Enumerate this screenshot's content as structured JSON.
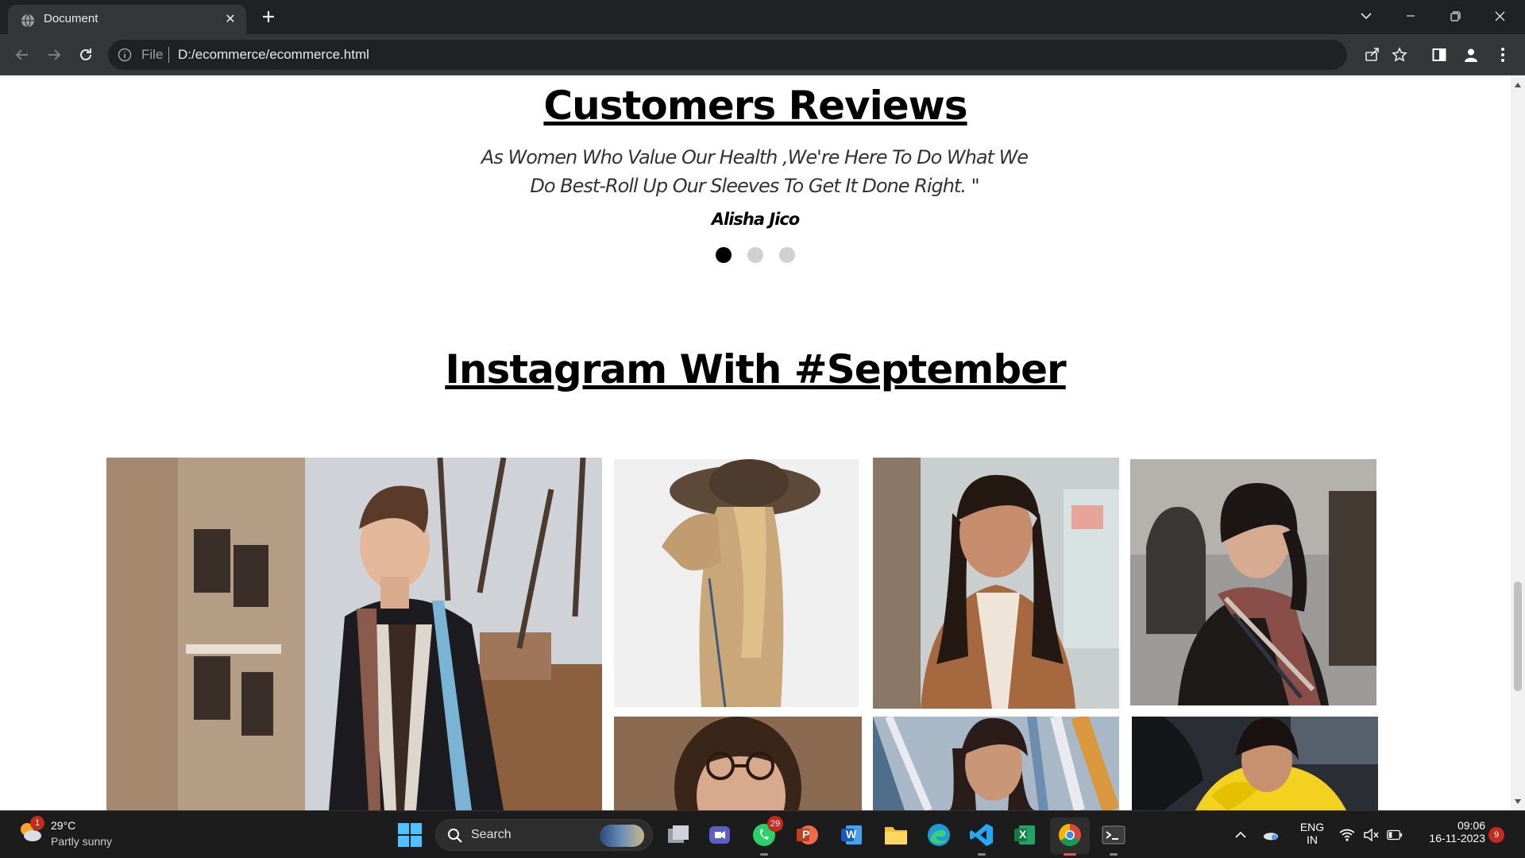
{
  "browser": {
    "tab_title": "Document",
    "omnibox_scheme": "File",
    "omnibox_url": "D:/ecommerce/ecommerce.html",
    "icons": [
      "globe-icon",
      "close-icon",
      "plus-icon",
      "chevron-down-icon",
      "minimize-icon",
      "restore-icon",
      "close-icon",
      "back-icon",
      "forward-icon",
      "reload-icon",
      "info-icon",
      "share-icon",
      "star-icon",
      "sidepanel-icon",
      "profile-icon",
      "more-icon"
    ]
  },
  "page": {
    "reviews": {
      "title": "Customers Reviews",
      "quote": "As Women Who Value Our Health ,We're Here To Do What We Do Best-Roll Up Our Sleeves To Get It Done Right. \"",
      "author": "Alisha Jico",
      "dots_active_index": 0,
      "dots_count": 3
    },
    "instagram": {
      "title": "Instagram With #September",
      "photos": [
        {
          "name": "man-in-coat-with-scarf-photo"
        },
        {
          "name": "woman-with-brown-hat-photo"
        },
        {
          "name": "smiling-woman-brown-jacket-photo"
        },
        {
          "name": "woman-with-plaid-scarf-photo"
        },
        {
          "name": "woman-with-glasses-photo"
        },
        {
          "name": "woman-graffiti-wall-photo"
        },
        {
          "name": "woman-yellow-fur-coat-photo"
        }
      ]
    }
  },
  "taskbar": {
    "weather_temp": "29°C",
    "weather_desc": "Partly sunny",
    "weather_badge": "1",
    "search_label": "Search",
    "whatsapp_badge": "29",
    "powerpoint_label": "P",
    "word_label": "W",
    "excel_label": "X",
    "lang_top": "ENG",
    "lang_bottom": "IN",
    "time": "09:06",
    "date": "16-11-2023",
    "notification_count": "9"
  },
  "colors": {
    "chrome_dark": "#202124",
    "chrome_toolbar": "#35363a",
    "active_dot": "#000000",
    "inactive_dot": "#d0d0d0",
    "taskbar": "#1c1c1c"
  }
}
